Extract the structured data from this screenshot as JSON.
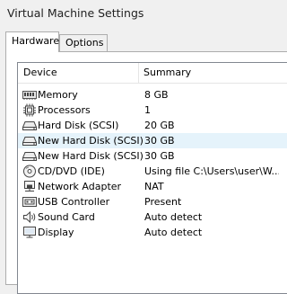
{
  "window": {
    "title": "Virtual Machine Settings"
  },
  "tabs": [
    {
      "label": "Hardware",
      "active": true
    },
    {
      "label": "Options",
      "active": false
    }
  ],
  "table": {
    "columns": {
      "device": "Device",
      "summary": "Summary"
    },
    "rows": [
      {
        "icon": "memory-icon",
        "device": "Memory",
        "summary": "8 GB"
      },
      {
        "icon": "processor-icon",
        "device": "Processors",
        "summary": "1"
      },
      {
        "icon": "hard-disk-icon",
        "device": "Hard Disk (SCSI)",
        "summary": "20 GB"
      },
      {
        "icon": "hard-disk-icon",
        "device": "New Hard Disk (SCSI)",
        "summary": "30 GB"
      },
      {
        "icon": "hard-disk-icon",
        "device": "New Hard Disk (SCSI)",
        "summary": "30 GB"
      },
      {
        "icon": "cd-dvd-icon",
        "device": "CD/DVD (IDE)",
        "summary": "Using file C:\\Users\\user\\W..."
      },
      {
        "icon": "network-adapter-icon",
        "device": "Network Adapter",
        "summary": "NAT"
      },
      {
        "icon": "usb-icon",
        "device": "USB Controller",
        "summary": "Present"
      },
      {
        "icon": "sound-card-icon",
        "device": "Sound Card",
        "summary": "Auto detect"
      },
      {
        "icon": "display-icon",
        "device": "Display",
        "summary": "Auto detect"
      }
    ]
  }
}
